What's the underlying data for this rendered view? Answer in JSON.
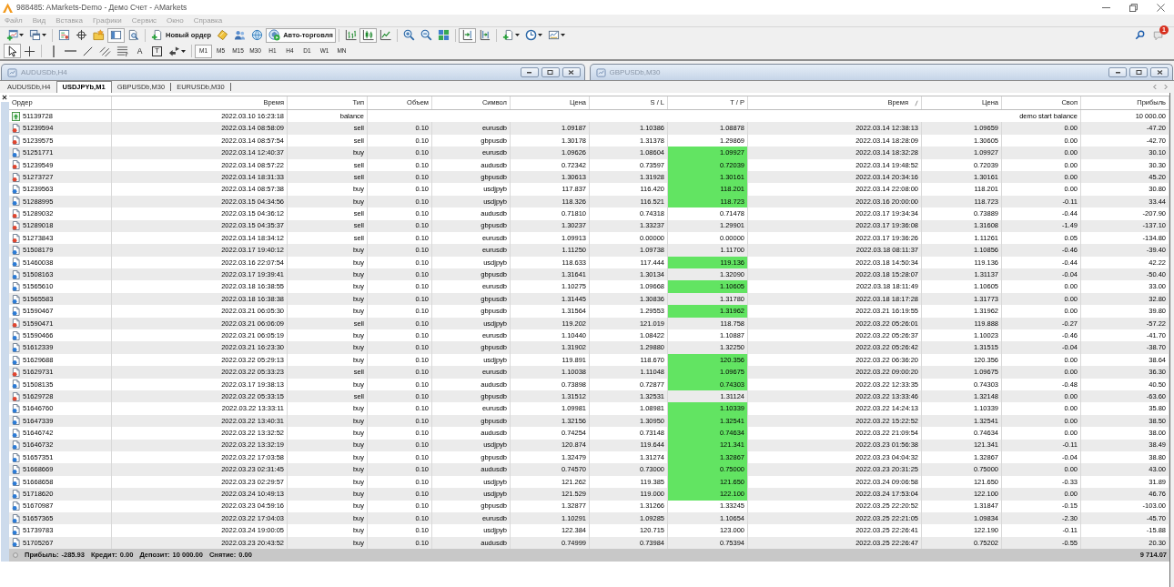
{
  "window": {
    "title": "988485: AMarkets-Demo - Демо Счет - AMarkets"
  },
  "menu": [
    "Файл",
    "Вид",
    "Вставка",
    "Графики",
    "Сервис",
    "Окно",
    "Справка"
  ],
  "toolbar_main": {
    "groups": [
      [
        {
          "kind": "icon",
          "pressed": false,
          "dropdown": true
        },
        {
          "kind": "icon",
          "pressed": false,
          "dropdown": true
        }
      ],
      [
        {
          "kind": "icon",
          "pressed": false,
          "dropdown": false
        },
        {
          "kind": "icon",
          "pressed": false,
          "dropdown": false
        },
        {
          "kind": "icon",
          "pressed": false,
          "dropdown": false
        },
        {
          "kind": "icon",
          "pressed": true,
          "dropdown": false
        },
        {
          "kind": "icon",
          "pressed": false,
          "dropdown": false
        }
      ],
      [
        {
          "kind": "button",
          "label": "Новый ордер",
          "pressed": false
        },
        {
          "kind": "icon",
          "pressed": false,
          "dropdown": false
        },
        {
          "kind": "icon",
          "pressed": false,
          "dropdown": false
        },
        {
          "kind": "icon",
          "pressed": false,
          "dropdown": false
        },
        {
          "kind": "button",
          "label": "Авто-торговля",
          "pressed": true
        }
      ],
      [
        {
          "kind": "icon",
          "pressed": false,
          "dropdown": false
        },
        {
          "kind": "icon",
          "pressed": true,
          "dropdown": false
        },
        {
          "kind": "icon",
          "pressed": false,
          "dropdown": false
        }
      ],
      [
        {
          "kind": "icon",
          "pressed": false,
          "dropdown": false
        },
        {
          "kind": "icon",
          "pressed": false,
          "dropdown": false
        },
        {
          "kind": "icon",
          "pressed": false,
          "dropdown": false
        }
      ],
      [
        {
          "kind": "icon",
          "pressed": true,
          "dropdown": false
        },
        {
          "kind": "icon",
          "pressed": false,
          "dropdown": false
        }
      ],
      [
        {
          "kind": "icon",
          "pressed": false,
          "dropdown": true
        },
        {
          "kind": "icon",
          "pressed": false,
          "dropdown": true
        },
        {
          "kind": "icon",
          "pressed": false,
          "dropdown": true
        }
      ]
    ]
  },
  "notifications": {
    "count": "1"
  },
  "toolbar_drawing": {
    "groups": [
      [
        {
          "kind": "icon",
          "pressed": true,
          "dropdown": false
        },
        {
          "kind": "icon",
          "pressed": false,
          "dropdown": false
        }
      ],
      [
        {
          "kind": "icon",
          "pressed": false,
          "dropdown": false
        },
        {
          "kind": "icon",
          "pressed": false,
          "dropdown": false
        },
        {
          "kind": "icon",
          "pressed": false,
          "dropdown": false
        },
        {
          "kind": "icon",
          "pressed": false,
          "dropdown": false
        },
        {
          "kind": "icon",
          "pressed": false,
          "dropdown": false
        },
        {
          "kind": "glyph",
          "glyph": "A",
          "framed": false
        },
        {
          "kind": "glyph",
          "glyph": "T",
          "framed": true
        },
        {
          "kind": "icon",
          "pressed": false,
          "dropdown": true
        }
      ]
    ]
  },
  "periods": [
    {
      "label": "M1",
      "selected": true
    },
    {
      "label": "M5",
      "selected": false
    },
    {
      "label": "M15",
      "selected": false
    },
    {
      "label": "M30",
      "selected": false
    },
    {
      "label": "H1",
      "selected": false
    },
    {
      "label": "H4",
      "selected": false
    },
    {
      "label": "D1",
      "selected": false
    },
    {
      "label": "W1",
      "selected": false
    },
    {
      "label": "MN",
      "selected": false
    }
  ],
  "chart_windows": [
    {
      "title": "AUDUSDb,H4"
    },
    {
      "title": "GBPUSDb,M30"
    }
  ],
  "chart_tabs": [
    {
      "label": "AUDUSDb,H4",
      "selected": false
    },
    {
      "label": "USDJPYb,M1",
      "selected": true
    },
    {
      "label": "GBPUSDb,M30",
      "selected": false
    },
    {
      "label": "EURUSDb,M30",
      "selected": false
    }
  ],
  "trade_table": {
    "columns": [
      {
        "label": "Ордер",
        "sorted": false
      },
      {
        "label": "Время",
        "sorted": false
      },
      {
        "label": "Тип",
        "sorted": false
      },
      {
        "label": "Объем",
        "sorted": false
      },
      {
        "label": "Символ",
        "sorted": false
      },
      {
        "label": "Цена",
        "sorted": false
      },
      {
        "label": "S / L",
        "sorted": false
      },
      {
        "label": "T / P",
        "sorted": false
      },
      {
        "label": "Время",
        "sorted": true
      },
      {
        "label": "Цена",
        "sorted": false
      },
      {
        "label": "Своп",
        "sorted": false
      },
      {
        "label": "Прибыль",
        "sorted": false
      }
    ],
    "rows": [
      {
        "kind": "balance",
        "order": "51139728",
        "time": "2022.03.10 16:23:18",
        "type": "balance",
        "comment": "demo start balance",
        "profit": "10 000.00"
      },
      {
        "kind": "sell",
        "order": "51239594",
        "time": "2022.03.14 08:58:09",
        "type": "sell",
        "volume": "0.10",
        "symbol": "eurusdb",
        "price": "1.09187",
        "sl": "1.10386",
        "tp": "1.08878",
        "tp_hit": false,
        "close_time": "2022.03.14 12:38:13",
        "close_price": "1.09659",
        "swap": "0.00",
        "profit": "-47.20"
      },
      {
        "kind": "sell",
        "order": "51239575",
        "time": "2022.03.14 08:57:54",
        "type": "sell",
        "volume": "0.10",
        "symbol": "gbpusdb",
        "price": "1.30178",
        "sl": "1.31378",
        "tp": "1.29869",
        "tp_hit": false,
        "close_time": "2022.03.14 18:28:09",
        "close_price": "1.30605",
        "swap": "0.00",
        "profit": "-42.70"
      },
      {
        "kind": "buy",
        "order": "51251771",
        "time": "2022.03.14 12:40:37",
        "type": "buy",
        "volume": "0.10",
        "symbol": "eurusdb",
        "price": "1.09626",
        "sl": "1.08604",
        "tp": "1.09927",
        "tp_hit": true,
        "close_time": "2022.03.14 18:32:28",
        "close_price": "1.09927",
        "swap": "0.00",
        "profit": "30.10"
      },
      {
        "kind": "sell",
        "order": "51239549",
        "time": "2022.03.14 08:57:22",
        "type": "sell",
        "volume": "0.10",
        "symbol": "audusdb",
        "price": "0.72342",
        "sl": "0.73597",
        "tp": "0.72039",
        "tp_hit": true,
        "close_time": "2022.03.14 19:48:52",
        "close_price": "0.72039",
        "swap": "0.00",
        "profit": "30.30"
      },
      {
        "kind": "sell",
        "order": "51273727",
        "time": "2022.03.14 18:31:33",
        "type": "sell",
        "volume": "0.10",
        "symbol": "gbpusdb",
        "price": "1.30613",
        "sl": "1.31928",
        "tp": "1.30161",
        "tp_hit": true,
        "close_time": "2022.03.14 20:34:16",
        "close_price": "1.30161",
        "swap": "0.00",
        "profit": "45.20"
      },
      {
        "kind": "buy",
        "order": "51239563",
        "time": "2022.03.14 08:57:38",
        "type": "buy",
        "volume": "0.10",
        "symbol": "usdjpyb",
        "price": "117.837",
        "sl": "116.420",
        "tp": "118.201",
        "tp_hit": true,
        "close_time": "2022.03.14 22:08:00",
        "close_price": "118.201",
        "swap": "0.00",
        "profit": "30.80"
      },
      {
        "kind": "buy",
        "order": "51288995",
        "time": "2022.03.15 04:34:56",
        "type": "buy",
        "volume": "0.10",
        "symbol": "usdjpyb",
        "price": "118.326",
        "sl": "116.521",
        "tp": "118.723",
        "tp_hit": true,
        "close_time": "2022.03.16 20:00:00",
        "close_price": "118.723",
        "swap": "-0.11",
        "profit": "33.44"
      },
      {
        "kind": "sell",
        "order": "51289032",
        "time": "2022.03.15 04:36:12",
        "type": "sell",
        "volume": "0.10",
        "symbol": "audusdb",
        "price": "0.71810",
        "sl": "0.74318",
        "tp": "0.71478",
        "tp_hit": false,
        "close_time": "2022.03.17 19:34:34",
        "close_price": "0.73889",
        "swap": "-0.44",
        "profit": "-207.90"
      },
      {
        "kind": "sell",
        "order": "51289018",
        "time": "2022.03.15 04:35:37",
        "type": "sell",
        "volume": "0.10",
        "symbol": "gbpusdb",
        "price": "1.30237",
        "sl": "1.33237",
        "tp": "1.29901",
        "tp_hit": false,
        "close_time": "2022.03.17 19:36:08",
        "close_price": "1.31608",
        "swap": "-1.49",
        "profit": "-137.10"
      },
      {
        "kind": "sell",
        "order": "51273843",
        "time": "2022.03.14 18:34:12",
        "type": "sell",
        "volume": "0.10",
        "symbol": "eurusdb",
        "price": "1.09913",
        "sl": "0.00000",
        "tp": "0.00000",
        "tp_hit": false,
        "close_time": "2022.03.17 19:36:26",
        "close_price": "1.11261",
        "swap": "0.05",
        "profit": "-134.80"
      },
      {
        "kind": "buy",
        "order": "51508179",
        "time": "2022.03.17 19:40:12",
        "type": "buy",
        "volume": "0.10",
        "symbol": "eurusdb",
        "price": "1.11250",
        "sl": "1.09738",
        "tp": "1.11700",
        "tp_hit": false,
        "close_time": "2022.03.18 08:11:37",
        "close_price": "1.10856",
        "swap": "-0.46",
        "profit": "-39.40"
      },
      {
        "kind": "buy",
        "order": "51460038",
        "time": "2022.03.16 22:07:54",
        "type": "buy",
        "volume": "0.10",
        "symbol": "usdjpyb",
        "price": "118.633",
        "sl": "117.444",
        "tp": "119.136",
        "tp_hit": true,
        "close_time": "2022.03.18 14:50:34",
        "close_price": "119.136",
        "swap": "-0.44",
        "profit": "42.22"
      },
      {
        "kind": "buy",
        "order": "51508163",
        "time": "2022.03.17 19:39:41",
        "type": "buy",
        "volume": "0.10",
        "symbol": "gbpusdb",
        "price": "1.31641",
        "sl": "1.30134",
        "tp": "1.32090",
        "tp_hit": false,
        "close_time": "2022.03.18 15:28:07",
        "close_price": "1.31137",
        "swap": "-0.04",
        "profit": "-50.40"
      },
      {
        "kind": "buy",
        "order": "51565610",
        "time": "2022.03.18 16:38:55",
        "type": "buy",
        "volume": "0.10",
        "symbol": "eurusdb",
        "price": "1.10275",
        "sl": "1.09668",
        "tp": "1.10605",
        "tp_hit": true,
        "close_time": "2022.03.18 18:11:49",
        "close_price": "1.10605",
        "swap": "0.00",
        "profit": "33.00"
      },
      {
        "kind": "buy",
        "order": "51565583",
        "time": "2022.03.18 16:38:38",
        "type": "buy",
        "volume": "0.10",
        "symbol": "gbpusdb",
        "price": "1.31445",
        "sl": "1.30836",
        "tp": "1.31780",
        "tp_hit": false,
        "close_time": "2022.03.18 18:17:28",
        "close_price": "1.31773",
        "swap": "0.00",
        "profit": "32.80"
      },
      {
        "kind": "buy",
        "order": "51590467",
        "time": "2022.03.21 06:05:30",
        "type": "buy",
        "volume": "0.10",
        "symbol": "gbpusdb",
        "price": "1.31564",
        "sl": "1.29553",
        "tp": "1.31962",
        "tp_hit": true,
        "close_time": "2022.03.21 16:19:55",
        "close_price": "1.31962",
        "swap": "0.00",
        "profit": "39.80"
      },
      {
        "kind": "sell",
        "order": "51590471",
        "time": "2022.03.21 06:06:09",
        "type": "sell",
        "volume": "0.10",
        "symbol": "usdjpyb",
        "price": "119.202",
        "sl": "121.019",
        "tp": "118.758",
        "tp_hit": false,
        "close_time": "2022.03.22 05:26:01",
        "close_price": "119.888",
        "swap": "-0.27",
        "profit": "-57.22"
      },
      {
        "kind": "buy",
        "order": "51590466",
        "time": "2022.03.21 06:05:19",
        "type": "buy",
        "volume": "0.10",
        "symbol": "eurusdb",
        "price": "1.10440",
        "sl": "1.08422",
        "tp": "1.10887",
        "tp_hit": false,
        "close_time": "2022.03.22 05:26:37",
        "close_price": "1.10023",
        "swap": "-0.46",
        "profit": "-41.70"
      },
      {
        "kind": "buy",
        "order": "51612339",
        "time": "2022.03.21 16:23:30",
        "type": "buy",
        "volume": "0.10",
        "symbol": "gbpusdb",
        "price": "1.31902",
        "sl": "1.29880",
        "tp": "1.32250",
        "tp_hit": false,
        "close_time": "2022.03.22 05:26:42",
        "close_price": "1.31515",
        "swap": "-0.04",
        "profit": "-38.70"
      },
      {
        "kind": "buy",
        "order": "51629688",
        "time": "2022.03.22 05:29:13",
        "type": "buy",
        "volume": "0.10",
        "symbol": "usdjpyb",
        "price": "119.891",
        "sl": "118.670",
        "tp": "120.356",
        "tp_hit": true,
        "close_time": "2022.03.22 06:36:20",
        "close_price": "120.356",
        "swap": "0.00",
        "profit": "38.64"
      },
      {
        "kind": "sell",
        "order": "51629731",
        "time": "2022.03.22 05:33:23",
        "type": "sell",
        "volume": "0.10",
        "symbol": "eurusdb",
        "price": "1.10038",
        "sl": "1.11048",
        "tp": "1.09675",
        "tp_hit": true,
        "close_time": "2022.03.22 09:00:20",
        "close_price": "1.09675",
        "swap": "0.00",
        "profit": "36.30"
      },
      {
        "kind": "buy",
        "order": "51508135",
        "time": "2022.03.17 19:38:13",
        "type": "buy",
        "volume": "0.10",
        "symbol": "audusdb",
        "price": "0.73898",
        "sl": "0.72877",
        "tp": "0.74303",
        "tp_hit": true,
        "close_time": "2022.03.22 12:33:35",
        "close_price": "0.74303",
        "swap": "-0.48",
        "profit": "40.50"
      },
      {
        "kind": "sell",
        "order": "51629728",
        "time": "2022.03.22 05:33:15",
        "type": "sell",
        "volume": "0.10",
        "symbol": "gbpusdb",
        "price": "1.31512",
        "sl": "1.32531",
        "tp": "1.31124",
        "tp_hit": false,
        "close_time": "2022.03.22 13:33:46",
        "close_price": "1.32148",
        "swap": "0.00",
        "profit": "-63.60"
      },
      {
        "kind": "buy",
        "order": "51646760",
        "time": "2022.03.22 13:33:11",
        "type": "buy",
        "volume": "0.10",
        "symbol": "eurusdb",
        "price": "1.09981",
        "sl": "1.08981",
        "tp": "1.10339",
        "tp_hit": true,
        "close_time": "2022.03.22 14:24:13",
        "close_price": "1.10339",
        "swap": "0.00",
        "profit": "35.80"
      },
      {
        "kind": "buy",
        "order": "51647339",
        "time": "2022.03.22 13:40:31",
        "type": "buy",
        "volume": "0.10",
        "symbol": "gbpusdb",
        "price": "1.32156",
        "sl": "1.30950",
        "tp": "1.32541",
        "tp_hit": true,
        "close_time": "2022.03.22 15:22:52",
        "close_price": "1.32541",
        "swap": "0.00",
        "profit": "38.50"
      },
      {
        "kind": "buy",
        "order": "51646742",
        "time": "2022.03.22 13:32:52",
        "type": "buy",
        "volume": "0.10",
        "symbol": "audusdb",
        "price": "0.74254",
        "sl": "0.73148",
        "tp": "0.74634",
        "tp_hit": true,
        "close_time": "2022.03.22 21:09:54",
        "close_price": "0.74634",
        "swap": "0.00",
        "profit": "38.00"
      },
      {
        "kind": "buy",
        "order": "51646732",
        "time": "2022.03.22 13:32:19",
        "type": "buy",
        "volume": "0.10",
        "symbol": "usdjpyb",
        "price": "120.874",
        "sl": "119.644",
        "tp": "121.341",
        "tp_hit": true,
        "close_time": "2022.03.23 01:56:38",
        "close_price": "121.341",
        "swap": "-0.11",
        "profit": "38.49"
      },
      {
        "kind": "buy",
        "order": "51657351",
        "time": "2022.03.22 17:03:58",
        "type": "buy",
        "volume": "0.10",
        "symbol": "gbpusdb",
        "price": "1.32479",
        "sl": "1.31274",
        "tp": "1.32867",
        "tp_hit": true,
        "close_time": "2022.03.23 04:04:32",
        "close_price": "1.32867",
        "swap": "-0.04",
        "profit": "38.80"
      },
      {
        "kind": "buy",
        "order": "51668669",
        "time": "2022.03.23 02:31:45",
        "type": "buy",
        "volume": "0.10",
        "symbol": "audusdb",
        "price": "0.74570",
        "sl": "0.73000",
        "tp": "0.75000",
        "tp_hit": true,
        "close_time": "2022.03.23 20:31:25",
        "close_price": "0.75000",
        "swap": "0.00",
        "profit": "43.00"
      },
      {
        "kind": "buy",
        "order": "51668658",
        "time": "2022.03.23 02:29:57",
        "type": "buy",
        "volume": "0.10",
        "symbol": "usdjpyb",
        "price": "121.262",
        "sl": "119.385",
        "tp": "121.650",
        "tp_hit": true,
        "close_time": "2022.03.24 09:06:58",
        "close_price": "121.650",
        "swap": "-0.33",
        "profit": "31.89"
      },
      {
        "kind": "buy",
        "order": "51718620",
        "time": "2022.03.24 10:49:13",
        "type": "buy",
        "volume": "0.10",
        "symbol": "usdjpyb",
        "price": "121.529",
        "sl": "119.000",
        "tp": "122.100",
        "tp_hit": true,
        "close_time": "2022.03.24 17:53:04",
        "close_price": "122.100",
        "swap": "0.00",
        "profit": "46.76"
      },
      {
        "kind": "buy",
        "order": "51670987",
        "time": "2022.03.23 04:59:16",
        "type": "buy",
        "volume": "0.10",
        "symbol": "gbpusdb",
        "price": "1.32877",
        "sl": "1.31266",
        "tp": "1.33245",
        "tp_hit": false,
        "close_time": "2022.03.25 22:20:52",
        "close_price": "1.31847",
        "swap": "-0.15",
        "profit": "-103.00"
      },
      {
        "kind": "buy",
        "order": "51657365",
        "time": "2022.03.22 17:04:03",
        "type": "buy",
        "volume": "0.10",
        "symbol": "eurusdb",
        "price": "1.10291",
        "sl": "1.09285",
        "tp": "1.10654",
        "tp_hit": false,
        "close_time": "2022.03.25 22:21:05",
        "close_price": "1.09834",
        "swap": "-2.30",
        "profit": "-45.70"
      },
      {
        "kind": "buy",
        "order": "51739783",
        "time": "2022.03.24 19:00:05",
        "type": "buy",
        "volume": "0.10",
        "symbol": "usdjpyb",
        "price": "122.384",
        "sl": "120.715",
        "tp": "123.000",
        "tp_hit": false,
        "close_time": "2022.03.25 22:26:41",
        "close_price": "122.190",
        "swap": "-0.11",
        "profit": "-15.88"
      },
      {
        "kind": "buy",
        "order": "51705267",
        "time": "2022.03.23 20:43:52",
        "type": "buy",
        "volume": "0.10",
        "symbol": "audusdb",
        "price": "0.74999",
        "sl": "0.73984",
        "tp": "0.75394",
        "tp_hit": false,
        "close_time": "2022.03.25 22:26:47",
        "close_price": "0.75202",
        "swap": "-0.55",
        "profit": "20.30"
      }
    ]
  },
  "summary": {
    "items": [
      {
        "label": "Прибыль:",
        "value": "-285.93"
      },
      {
        "label": "Кредит:",
        "value": "0.00"
      },
      {
        "label": "Депозит:",
        "value": "10 000.00"
      },
      {
        "label": "Снятие:",
        "value": "0.00"
      }
    ],
    "total": "9 714.07"
  }
}
